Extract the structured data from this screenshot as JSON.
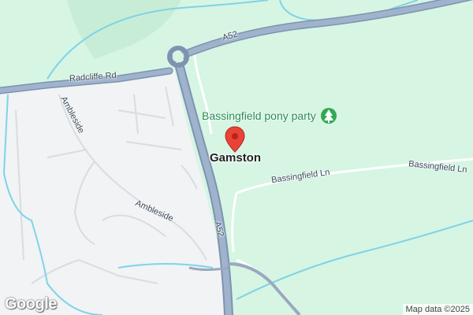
{
  "map": {
    "roads": {
      "a52_top": "A52",
      "a52_side": "A52",
      "radcliffe": "Radcliffe Rd",
      "ambleside_1": "Ambleside",
      "ambleside_2": "Ambleside",
      "bassingfield_1": "Bassingfield Ln",
      "bassingfield_2": "Bassingfield Ln"
    },
    "poi": {
      "label": "Bassingfield pony party",
      "icon": "park-tree-icon",
      "color": "#34a853"
    },
    "place": {
      "label": "Gamston",
      "marker_icon": "map-pin-icon",
      "marker_color": "#ea4335"
    },
    "attribution": "Map data ©2025",
    "logo": "Google",
    "colors": {
      "grass": "#d6f5e3",
      "urban": "#f1f3f4",
      "motorway": "#8aa0bd",
      "water": "#7fd3e8"
    }
  }
}
